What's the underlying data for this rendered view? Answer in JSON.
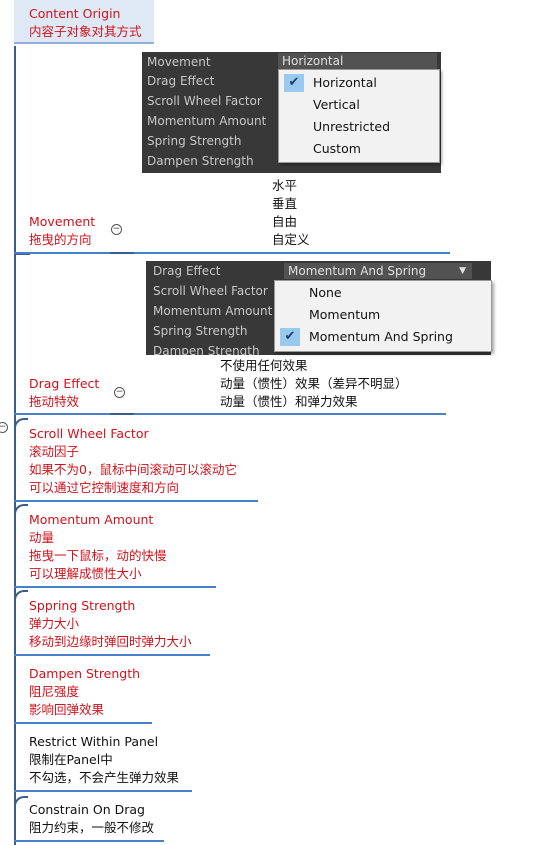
{
  "nodes": {
    "content_origin": {
      "title": "Content Origin",
      "desc": "内容子对象对其方式"
    },
    "movement": {
      "title": "Movement",
      "desc": "拖曳的方向"
    },
    "drag_effect": {
      "title": "Drag Effect",
      "desc": "拖动特效"
    },
    "scroll_wheel": {
      "title": "Scroll Wheel Factor",
      "desc1": "滚动因子",
      "desc2": "如果不为0，鼠标中间滚动可以滚动它",
      "desc3": "可以通过它控制速度和方向"
    },
    "momentum": {
      "title": "Momentum Amount",
      "desc1": "动量",
      "desc2": "拖曳一下鼠标，动的快慢",
      "desc3": "可以理解成惯性大小"
    },
    "spring": {
      "title": "Sppring Strength",
      "desc1": "弹力大小",
      "desc2": "移动到边缘时弹回时弹力大小"
    },
    "dampen": {
      "title": "Dampen Strength",
      "desc1": "阻尼强度",
      "desc2": "影响回弹效果"
    },
    "restrict": {
      "title": "Restrict Within Panel",
      "desc1": "限制在Panel中",
      "desc2": "不勾选，不会产生弹力效果"
    },
    "constrain": {
      "title": "Constrain On Drag",
      "desc1": "阻力约束，一般不修改"
    }
  },
  "inspector1": {
    "rows": [
      "Movement",
      "Drag Effect",
      "Scroll Wheel Factor",
      "Momentum Amount",
      "Spring Strength",
      "Dampen Strength"
    ],
    "field_value": "Horizontal",
    "options": [
      "Horizontal",
      "Vertical",
      "Unrestricted",
      "Custom"
    ],
    "selected_index": 0
  },
  "movement_notes": [
    "水平",
    "垂直",
    "自由",
    "自定义"
  ],
  "inspector2": {
    "rows": [
      "Drag Effect",
      "Scroll Wheel Factor",
      "Momentum Amount",
      "Spring Strength",
      "Dampen Strength"
    ],
    "field_value": "Momentum And Spring",
    "options": [
      "None",
      "Momentum",
      "Momentum And Spring"
    ],
    "selected_index": 2
  },
  "drag_notes": [
    "不使用任何效果",
    "动量（惯性）效果（差异不明显）",
    "动量（惯性）和弹力效果"
  ],
  "colors": {
    "accent_line": "#4a7fc9",
    "node_title": "#d0121b",
    "inspector_bg": "#383838",
    "check_bg": "#99c9ef"
  }
}
